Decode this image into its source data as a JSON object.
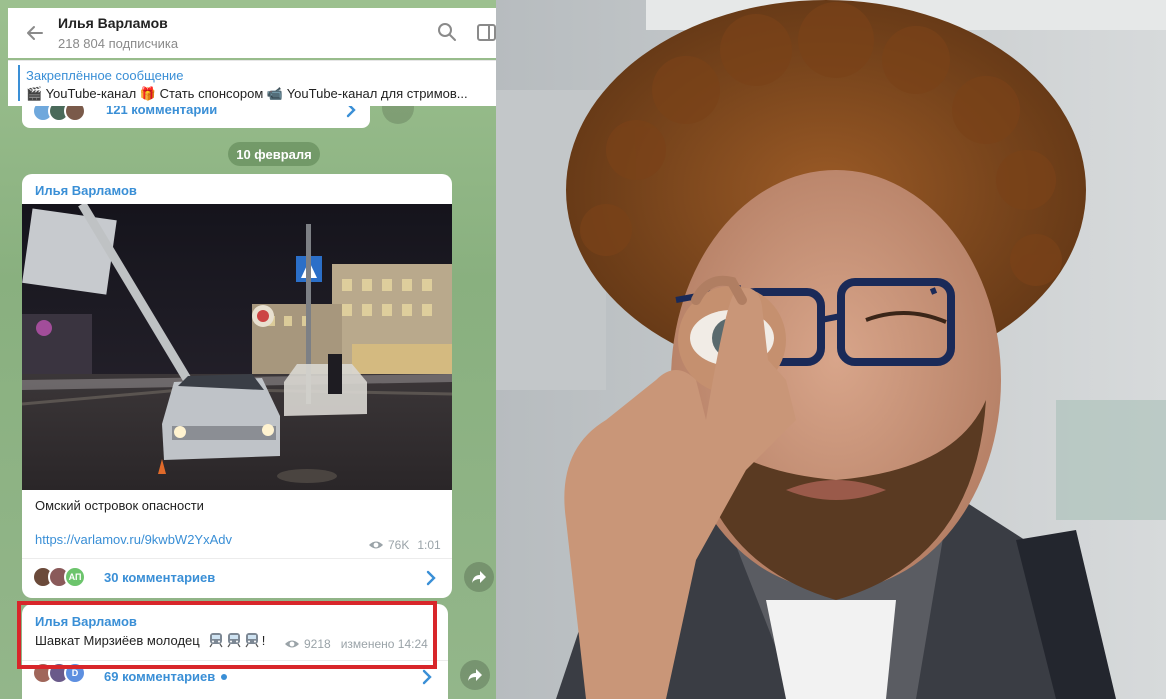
{
  "header": {
    "channel_name": "Илья Варламов",
    "subscribers": "218 804 подписчика"
  },
  "pinned": {
    "title": "Закреплённое сообщение",
    "text": "🎬 YouTube-канал 🎁 Стать спонсором 📹 YouTube-канал для стримов..."
  },
  "previous_post": {
    "comments_label": "121 комментарии"
  },
  "date_separator": "10 февраля",
  "post": {
    "author": "Илья Варламов",
    "caption": "Омский островок опасности",
    "link": "https://varlamov.ru/9kwbW2YxAdv",
    "views": "76K",
    "time": "1:01",
    "comments_label": "30 комментариев",
    "comment_avatar_initials": "АП"
  },
  "post2": {
    "author": "Илья Варламов",
    "text": "Шавкат Мирзиёев молодец",
    "text_suffix": "!",
    "views": "9218",
    "edited": "изменено 14:24",
    "comments_label": "69 комментариев",
    "comment_avatar_initial": "D"
  },
  "colors": {
    "accent": "#3a8fd6",
    "highlight": "#d8262a",
    "chat_background": "#8fb489"
  }
}
